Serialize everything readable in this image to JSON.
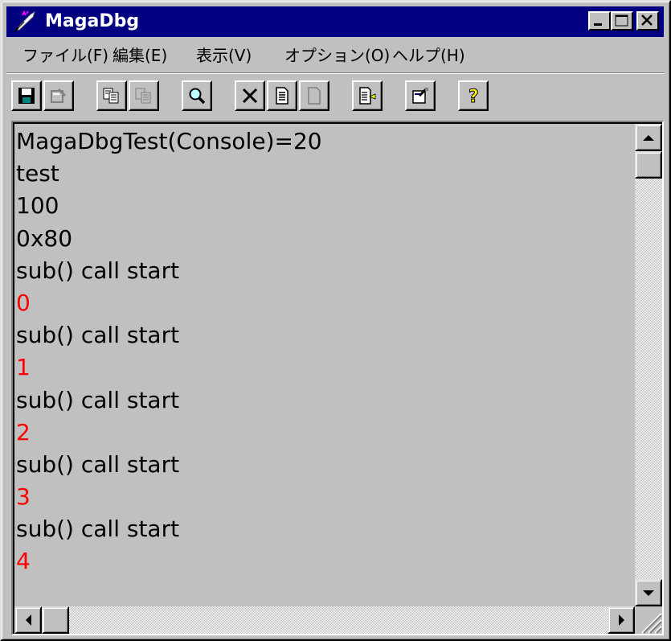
{
  "window": {
    "title": "MagaDbg",
    "app_icon": "quill-pen-icon",
    "controls": [
      "minimize-icon",
      "maximize-icon",
      "close-icon"
    ]
  },
  "menu": [
    {
      "label": "ファイル(F)"
    },
    {
      "label": "編集(E)"
    },
    {
      "label": "表示(V)"
    },
    {
      "label": "オプション(O)"
    },
    {
      "label": "ヘルプ(H)"
    }
  ],
  "toolbar": {
    "buttons": [
      {
        "icon": "save-icon",
        "enabled": true
      },
      {
        "icon": "properties-icon",
        "enabled": false
      },
      {
        "icon": "copy-icon",
        "enabled": true
      },
      {
        "icon": "paste-icon",
        "enabled": false
      },
      {
        "icon": "find-icon",
        "enabled": true
      },
      {
        "icon": "delete-icon",
        "enabled": true
      },
      {
        "icon": "document-icon",
        "enabled": true
      },
      {
        "icon": "blank-document-icon",
        "enabled": false
      },
      {
        "icon": "import-document-icon",
        "enabled": true
      },
      {
        "icon": "settings-icon",
        "enabled": true
      },
      {
        "icon": "help-icon",
        "enabled": true
      }
    ]
  },
  "log": {
    "lines": [
      {
        "text": "MagaDbgTest(Console)=20",
        "color": "#000000"
      },
      {
        "text": "test",
        "color": "#000000"
      },
      {
        "text": "100",
        "color": "#000000"
      },
      {
        "text": "0x80",
        "color": "#000000"
      },
      {
        "text": "sub() call start",
        "color": "#000000"
      },
      {
        "text": "0",
        "color": "#ff0000"
      },
      {
        "text": "sub() call start",
        "color": "#000000"
      },
      {
        "text": "1",
        "color": "#ff0000"
      },
      {
        "text": "sub() call start",
        "color": "#000000"
      },
      {
        "text": "2",
        "color": "#ff0000"
      },
      {
        "text": "sub() call start",
        "color": "#000000"
      },
      {
        "text": "3",
        "color": "#ff0000"
      },
      {
        "text": "sub() call start",
        "color": "#000000"
      },
      {
        "text": "4",
        "color": "#ff0000"
      }
    ]
  },
  "scrollbars": {
    "vertical_position": 0,
    "horizontal_position": 0
  }
}
